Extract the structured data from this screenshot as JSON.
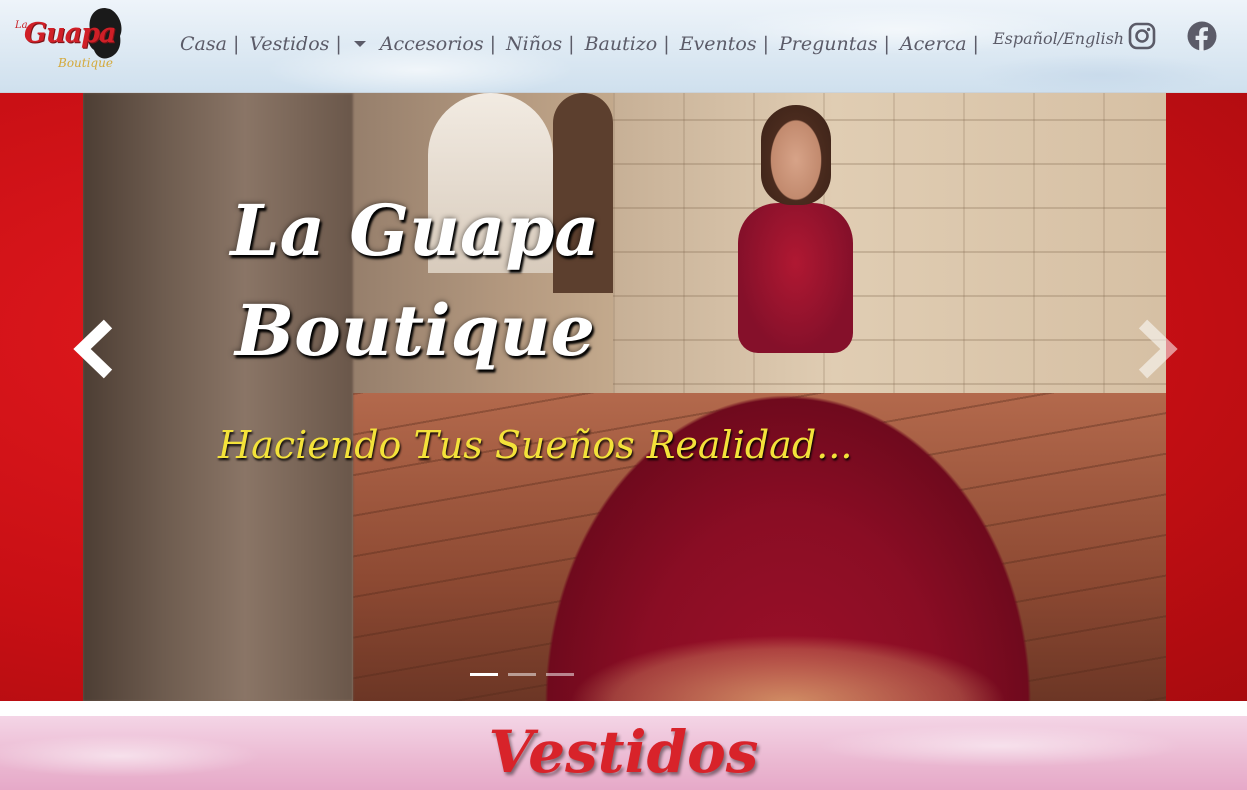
{
  "brand": {
    "logo_small": "La",
    "logo_main": "Guapa",
    "logo_sub": "Boutique"
  },
  "nav": {
    "items": [
      {
        "label": "Casa"
      },
      {
        "label": "Vestidos"
      },
      {
        "label": "Accesorios"
      },
      {
        "label": "Niños"
      },
      {
        "label": "Bautizo"
      },
      {
        "label": "Eventos"
      },
      {
        "label": "Preguntas"
      },
      {
        "label": "Acerca"
      }
    ],
    "separator": "|",
    "language_toggle": "Español/English"
  },
  "social": {
    "icons": [
      "instagram-icon",
      "facebook-icon"
    ]
  },
  "hero": {
    "title_line1": "La Guapa",
    "title_line2": "Boutique",
    "tagline": "Haciendo Tus Sueños Realidad...",
    "prev_icon": "chevron-left-icon",
    "next_icon": "chevron-right-icon"
  },
  "section": {
    "title": "Vestidos"
  },
  "colors": {
    "accent_red": "#d8232a",
    "tagline_yellow": "#f3e23a",
    "nav_text": "#5b5b68"
  }
}
